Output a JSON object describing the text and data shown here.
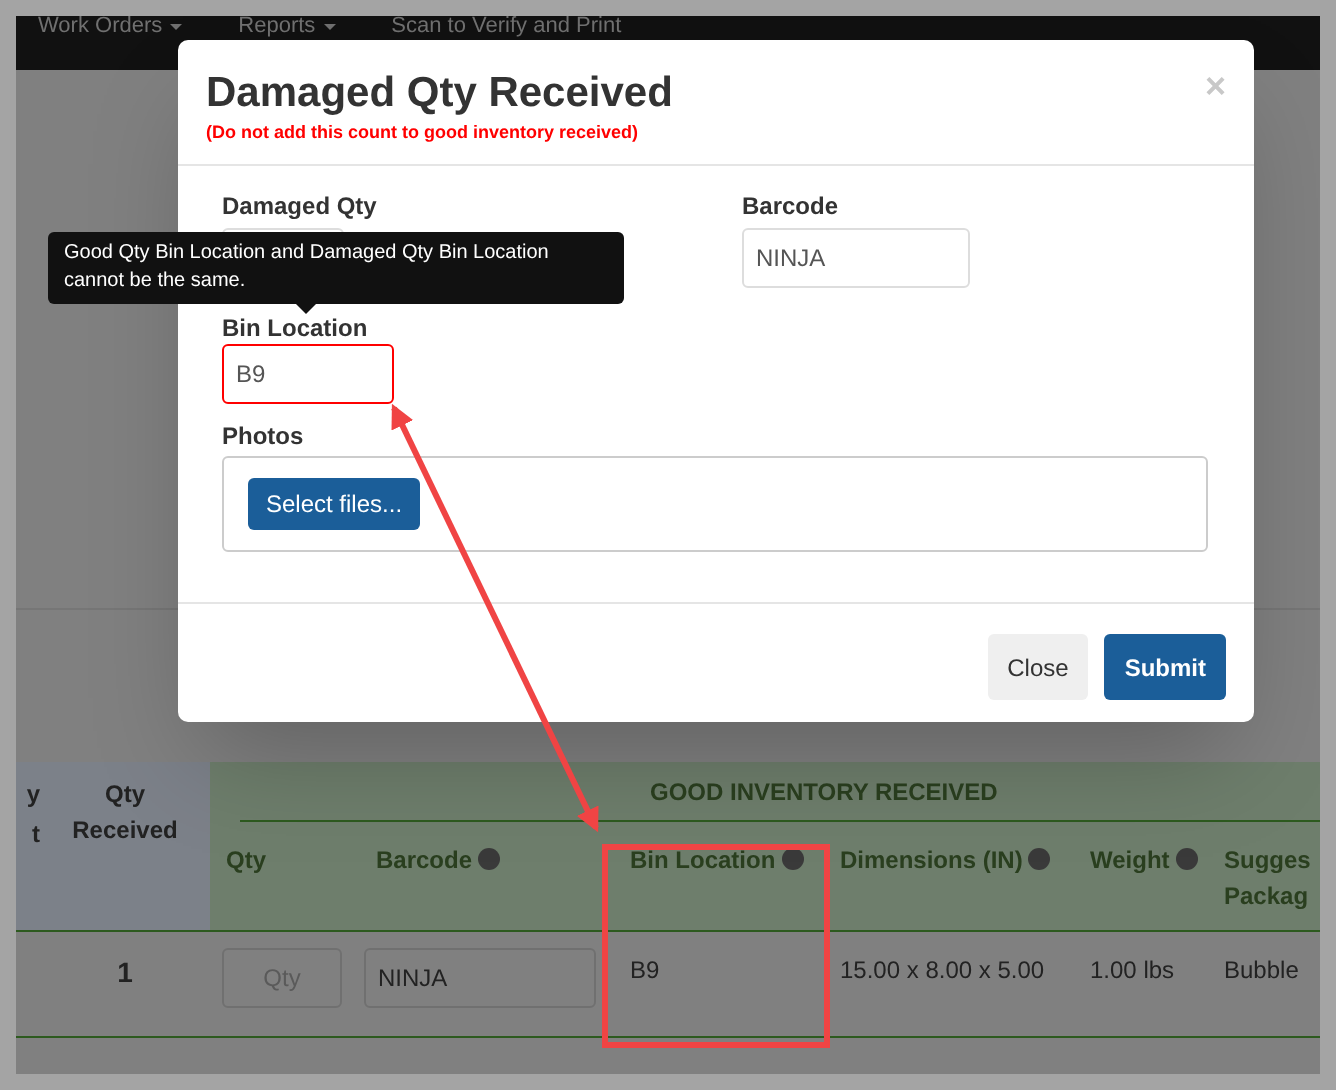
{
  "navbar": {
    "items": [
      {
        "label": "Work Orders",
        "dropdown": true
      },
      {
        "label": "Reports",
        "dropdown": true
      },
      {
        "label": "Scan to Verify and Print",
        "dropdown": false
      }
    ]
  },
  "table": {
    "column_1_fragment": [
      "y",
      "t"
    ],
    "qty_received_header": "Qty Received",
    "group_header": "GOOD INVENTORY RECEIVED",
    "columns": [
      {
        "label": "Qty",
        "help": false
      },
      {
        "label": "Barcode",
        "help": true
      },
      {
        "label": "Bin Location",
        "help": true
      },
      {
        "label": "Dimensions (IN)",
        "help": true
      },
      {
        "label": "Weight",
        "help": true
      },
      {
        "label": "Sugges Packag",
        "help": false
      }
    ],
    "rows": [
      {
        "qty_received": "1",
        "qty_placeholder": "Qty",
        "barcode": "NINJA",
        "bin_location": "B9",
        "dimensions": "15.00 x 8.00 x 5.00",
        "weight": "1.00 lbs",
        "packaging": "Bubble"
      }
    ]
  },
  "modal": {
    "title": "Damaged Qty Received",
    "subtitle": "(Do not add this count to good inventory received)",
    "close": "×",
    "damaged_qty_label": "Damaged Qty",
    "barcode_label": "Barcode",
    "barcode_value": "NINJA",
    "bin_location_label": "Bin Location",
    "bin_location_value": "B9",
    "bin_location_invalid": true,
    "photos_label": "Photos",
    "select_files": "Select files...",
    "buttons": [
      {
        "label": "Close",
        "kind": "default"
      },
      {
        "label": "Submit",
        "kind": "primary"
      }
    ]
  },
  "tooltip": {
    "text": "Good Qty Bin Location and Damaged Qty Bin Location cannot be the same."
  }
}
